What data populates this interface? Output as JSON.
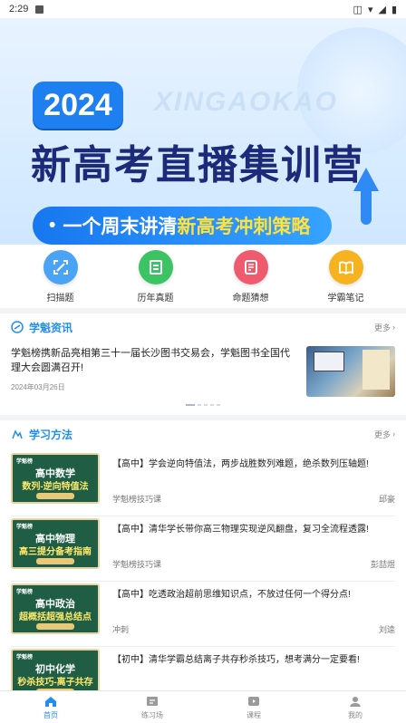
{
  "status_bar": {
    "time": "2:29"
  },
  "banner": {
    "year": "2024",
    "watermark": "XINGAOKAO",
    "headline_part1": "新高考",
    "headline_part2": "直播集训营",
    "pill_text": "一个周末讲清",
    "pill_accent": "新高考冲刺策略"
  },
  "quick_links": [
    {
      "label": "扫描题",
      "icon": "scan-icon",
      "color": "#4aa3f5"
    },
    {
      "label": "历年真题",
      "icon": "exam-paper-icon",
      "color": "#3cc464"
    },
    {
      "label": "命题猜想",
      "icon": "guess-icon",
      "color": "#f05a6e"
    },
    {
      "label": "学霸笔记",
      "icon": "notebook-icon",
      "color": "#f6b21f"
    }
  ],
  "news": {
    "section_title": "学魁资讯",
    "more": "更多",
    "title": "学魁榜携新品亮相第三十一届长沙图书交易会，学魁图书全国代理大会圆满召开!",
    "date": "2024年03月26日"
  },
  "methods": {
    "section_title": "学习方法",
    "more": "更多",
    "items": [
      {
        "thumb_l1": "高中数学",
        "thumb_l2": "数列-逆向特值法",
        "title": "【高中】学会逆向特值法，两步战胜数列难题，绝杀数列压轴题!",
        "author": "学魁榜技巧课",
        "teacher": "邱豪"
      },
      {
        "thumb_l1": "高中物理",
        "thumb_l2": "高三提分备考指南",
        "title": "【高中】清华学长带你高三物理实现逆风翻盘，复习全流程透露!",
        "author": "学魁榜技巧课",
        "teacher": "彭喆煜"
      },
      {
        "thumb_l1": "高中政治",
        "thumb_l2": "超概括超强总结点",
        "title": "【高中】吃透政治超前思维知识点，不放过任何一个得分点!",
        "author": "冲刺",
        "teacher": "刘逵"
      },
      {
        "thumb_l1": "初中化学",
        "thumb_l2": "秒杀技巧-离子共存",
        "title": "【初中】清华学霸总结离子共存秒杀技巧，想考满分一定要看!",
        "author": "",
        "teacher": ""
      }
    ]
  },
  "tabbar": [
    {
      "label": "首页",
      "icon": "home-icon",
      "active": true
    },
    {
      "label": "练习场",
      "icon": "practice-icon",
      "active": false
    },
    {
      "label": "课程",
      "icon": "course-play-icon",
      "active": false
    },
    {
      "label": "我的",
      "icon": "profile-icon",
      "active": false
    }
  ],
  "colors": {
    "accent": "#1f8ef0",
    "banner_blue": "#1d7ff0",
    "chalkboard": "#1f5e45"
  }
}
